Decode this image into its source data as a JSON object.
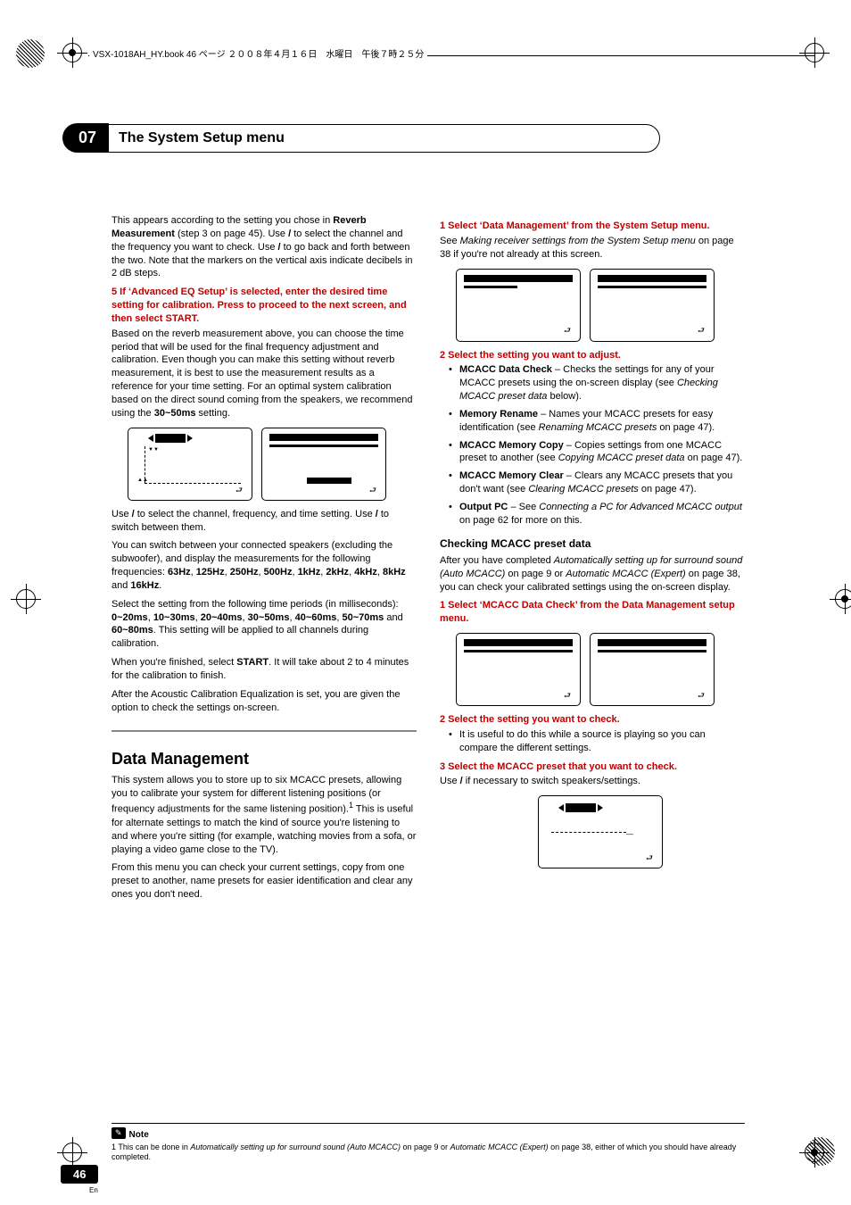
{
  "header_text": "VSX-1018AH_HY.book  46 ページ  ２００８年４月１６日　水曜日　午後７時２５分",
  "chapter": {
    "number": "07",
    "title": "The System Setup menu"
  },
  "page_number": "46",
  "page_lang": "En",
  "left": {
    "p1a": "This appears according to the setting you chose in ",
    "p1b": "Reverb Measurement",
    "p1c": " (step 3 on page 45). Use ",
    "p1d": " to select the channel and the frequency you want to check. Use ",
    "p1e": " to go back and forth between the two. Note that the markers on the vertical axis indicate decibels in 2 dB steps.",
    "step5": "5    If ‘Advanced EQ Setup’ is selected, enter the desired time setting for calibration. Press  to proceed to the next screen, and then select START.",
    "p2": "Based on the reverb measurement above, you can choose the time period that will be used for the final frequency adjustment and calibration. Even though you can make this setting without reverb measurement, it is best to use the measurement results as a reference for your time setting. For an optimal system calibration based on the direct sound coming from the speakers, we recommend using the ",
    "p2b": "30~50ms",
    "p2c": " setting.",
    "p3a": "Use ",
    "p3b": " to select the channel, frequency, and time setting. Use ",
    "p3c": " to switch between them.",
    "p4a": "You can switch between your connected speakers (excluding the subwoofer), and display the measurements for the following frequencies: ",
    "freqs": [
      "63Hz",
      "125Hz",
      "250Hz",
      "500Hz",
      "1kHz",
      "2kHz",
      "4kHz",
      "8kHz",
      "16kHz"
    ],
    "p4b": " and ",
    "p4c": ".",
    "p5a": "Select the setting from the following time periods (in milliseconds): ",
    "times": [
      "0~20ms",
      "10~30ms",
      "20~40ms",
      "30~50ms",
      "40~60ms",
      "50~70ms",
      "60~80ms"
    ],
    "p5b": " and ",
    "p5c": ". This setting will be applied to all channels during calibration.",
    "p6a": "When you're finished, select ",
    "p6b": "START",
    "p6c": ". It will take about 2 to 4 minutes for the calibration to finish.",
    "p7": "After the Acoustic Calibration Equalization is set, you are given the option to check the settings on-screen.",
    "h2": "Data Management",
    "p8": "This system allows you to store up to six MCACC presets, allowing you to calibrate your system for different listening positions (or frequency adjustments for the same listening position).",
    "p8sup": "1",
    "p8b": " This is useful for alternate settings to match the kind of source you're listening to and where you're sitting (for example, watching movies from a sofa, or playing a video game close to the TV).",
    "p9": "From this menu you can check your current settings, copy from one preset to another, name presets for easier identification and clear any ones you don't need."
  },
  "right": {
    "step1": "1    Select ‘Data Management’ from the System Setup menu.",
    "p1a": "See ",
    "p1b": "Making receiver settings from the System Setup menu",
    "p1c": " on page 38 if you're not already at this screen.",
    "step2": "2    Select the setting you want to adjust.",
    "items": [
      {
        "name": "MCACC Data Check",
        "desc_a": " – Checks the settings for any of your MCACC presets using the on-screen display (see ",
        "desc_i": "Checking MCACC preset data",
        "desc_b": " below)."
      },
      {
        "name": "Memory Rename",
        "desc_a": " – Names your MCACC presets for easy identification (see ",
        "desc_i": "Renaming MCACC presets",
        "desc_b": " on page 47)."
      },
      {
        "name": "MCACC Memory Copy",
        "desc_a": " – Copies settings from one MCACC preset to another (see ",
        "desc_i": "Copying MCACC preset data",
        "desc_b": " on page 47)."
      },
      {
        "name": "MCACC Memory Clear",
        "desc_a": " – Clears any MCACC presets that you don't want (see ",
        "desc_i": "Clearing MCACC presets",
        "desc_b": " on page 47)."
      },
      {
        "name": "Output PC",
        "desc_a": " – See ",
        "desc_i": "Connecting a PC for Advanced MCACC output",
        "desc_b": " on page 62 for more on this."
      }
    ],
    "h3": "Checking MCACC preset data",
    "p2a": "After you have completed ",
    "p2b": "Automatically setting up for surround sound (Auto MCACC)",
    "p2c": " on page 9 or ",
    "p2d": "Automatic MCACC (Expert)",
    "p2e": " on page 38, you can check your calibrated settings using the on-screen display.",
    "step1b": "1    Select ‘MCACC Data Check’ from the Data Management setup menu.",
    "step2b": "2    Select the setting you want to check.",
    "bullet2b": "It is useful to do this while a source is playing so you can compare the different settings.",
    "step3": "3    Select the MCACC preset that you want to check.",
    "p3a": "Use ",
    "p3b": " if necessary to switch speakers/settings."
  },
  "note": {
    "label": "Note",
    "text_a": "1 This can be done in ",
    "text_i1": "Automatically setting up for surround sound (Auto MCACC)",
    "text_b": " on page 9 or ",
    "text_i2": "Automatic MCACC (Expert)",
    "text_c": " on page 38, either of which you should have already completed."
  },
  "glyphs": {
    "lr": "/",
    "ud": "/",
    "down": ""
  }
}
